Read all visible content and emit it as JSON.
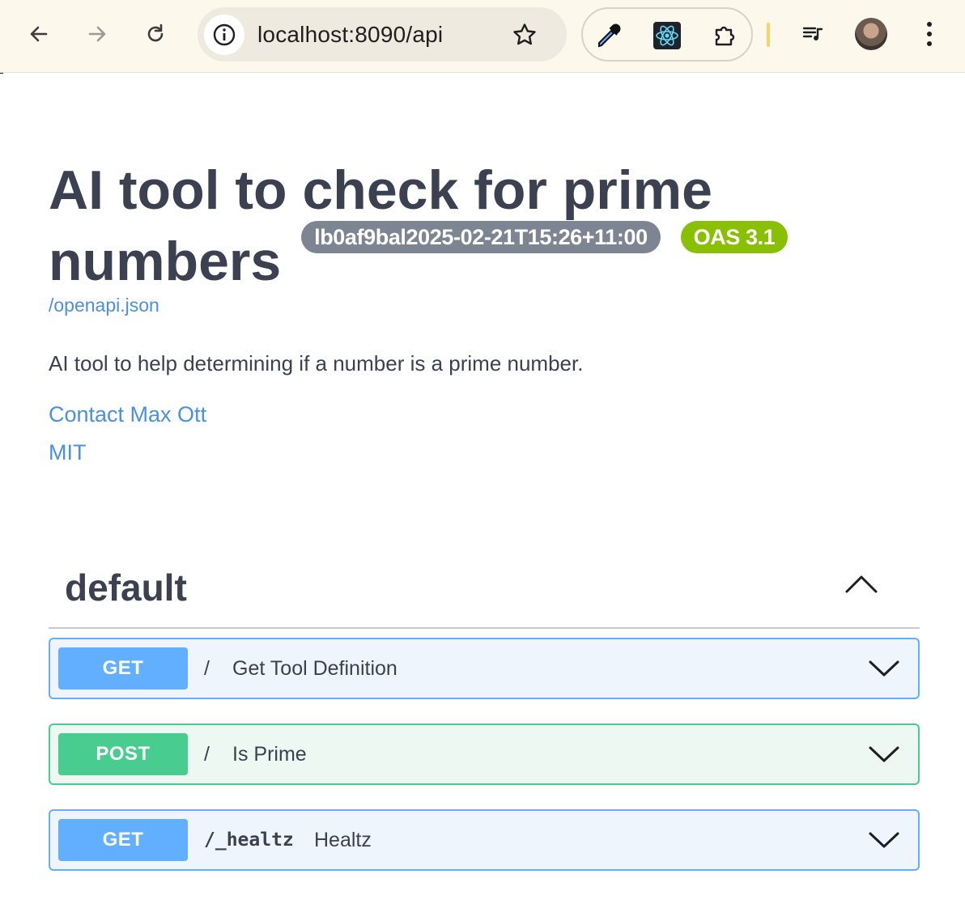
{
  "browser": {
    "url": "localhost:8090/api",
    "icons": {
      "back": "arrow-left-icon",
      "forward": "arrow-right-icon",
      "reload": "reload-icon",
      "site_info": "info-icon",
      "bookmark": "star-icon",
      "ext_colorpicker": "eyedropper-icon",
      "ext_react": "react-icon",
      "extensions": "puzzle-icon",
      "media": "playlist-music-icon",
      "profile": "avatar",
      "menu": "kebab-menu-icon"
    }
  },
  "info": {
    "title": "AI tool to check for prime numbers",
    "version_badge": "lb0af9bal2025-02-21T15:26+11:00",
    "oas_badge": "OAS 3.1",
    "spec_link": "/openapi.json",
    "description": "AI tool to help determining if a number is a prime number.",
    "contact": "Contact Max Ott",
    "license": "MIT"
  },
  "operations": {
    "tag": "default",
    "items": [
      {
        "method": "GET",
        "path": "/",
        "summary": "Get Tool Definition"
      },
      {
        "method": "POST",
        "path": "/",
        "summary": "Is Prime"
      },
      {
        "method": "GET",
        "path": "/_healtz",
        "summary": "Healtz"
      }
    ]
  },
  "colors": {
    "get": "#61affe",
    "post": "#49cc90",
    "version_badge": "#7d8492",
    "oas_badge": "#89bf04",
    "link": "#4990e2",
    "text": "#3b4151"
  }
}
